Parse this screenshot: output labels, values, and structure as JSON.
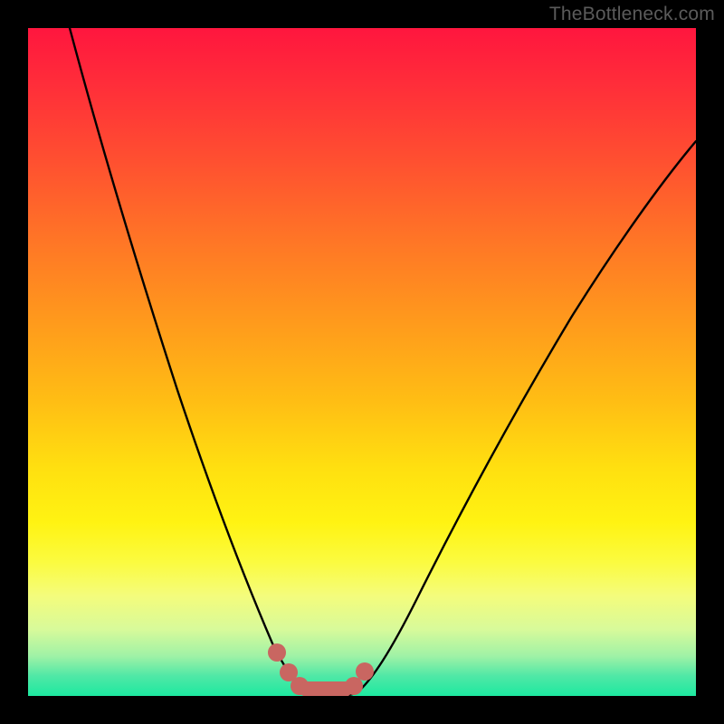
{
  "watermark": "TheBottleneck.com",
  "colors": {
    "frame": "#000000",
    "curve": "#000000",
    "marker": "#c96661",
    "gradient_stops": [
      "#ff163e",
      "#ff2c3a",
      "#ff5030",
      "#ff7626",
      "#ff9a1c",
      "#ffbe14",
      "#ffe010",
      "#fff312",
      "#fbfb40",
      "#f4fc7c",
      "#d8fa9a",
      "#a0f2a6",
      "#50e8a6",
      "#1de9a0"
    ]
  },
  "chart_data": {
    "type": "line",
    "title": "",
    "xlabel": "",
    "ylabel": "",
    "xlim": [
      0,
      100
    ],
    "ylim": [
      0,
      100
    ],
    "notes": "Gradient background: red (≈100) at top → green (≈0) at bottom. Curve is a V-shaped valley reaching ≈0 around x≈40–48.",
    "series": [
      {
        "name": "bottleneck-curve",
        "x": [
          6,
          10,
          15,
          20,
          25,
          30,
          33,
          36,
          38,
          40,
          42,
          44,
          46,
          48,
          50,
          55,
          60,
          65,
          70,
          75,
          80,
          85,
          90,
          95,
          100
        ],
        "y": [
          100,
          85,
          70,
          56,
          42,
          28,
          20,
          12,
          6,
          2,
          0.5,
          0,
          0.5,
          1.5,
          4,
          12,
          22,
          32,
          42,
          51,
          59,
          66,
          72,
          78,
          83
        ]
      }
    ],
    "markers": {
      "name": "valley-highlight",
      "approx_x_range": [
        36,
        49
      ],
      "approx_y_range": [
        0,
        6
      ],
      "shape": "rounded-dots",
      "color": "#c96661"
    }
  }
}
